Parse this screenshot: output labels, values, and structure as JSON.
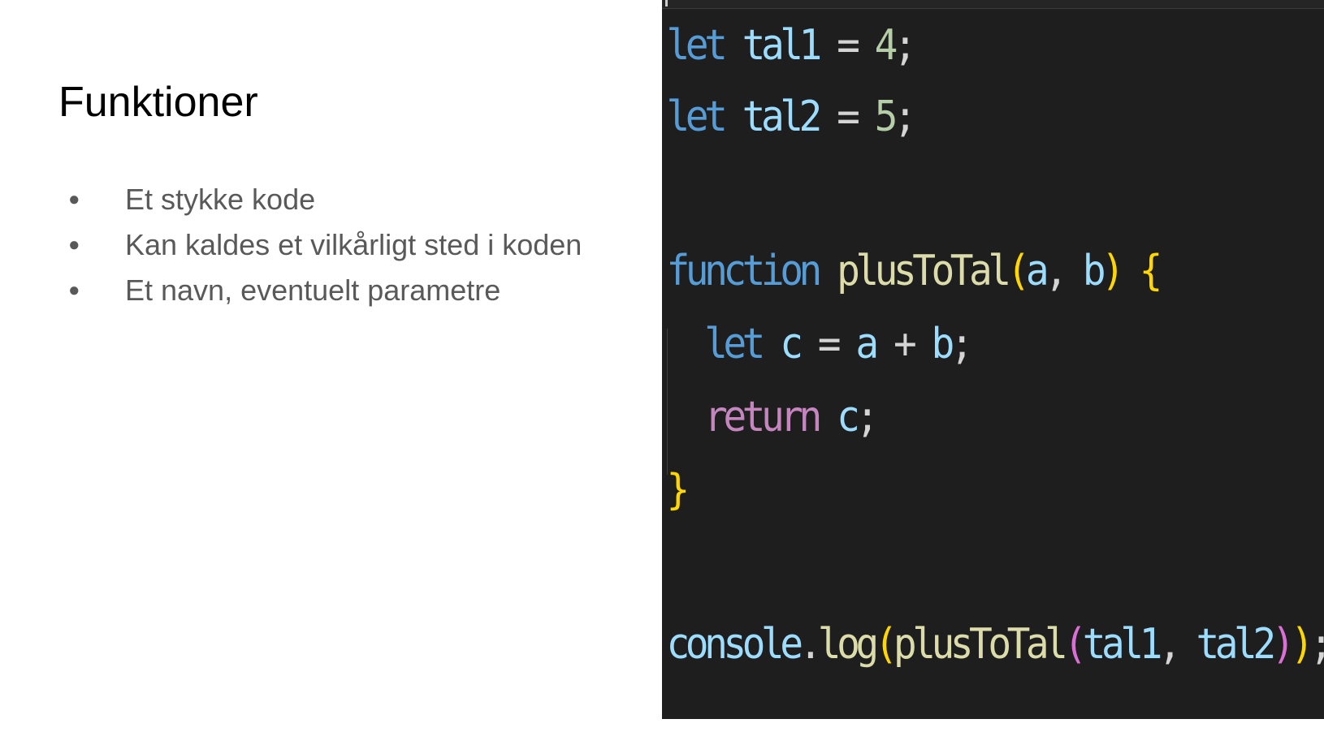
{
  "slide": {
    "title": "Funktioner",
    "bullets": [
      "Et stykke kode",
      "Kan kaldes et vilkårligt sted i koden",
      "Et navn, eventuelt parametre"
    ],
    "bullet_glyph": "●"
  },
  "code": {
    "line1": {
      "kw": "let",
      "name": "tal1",
      "op": "=",
      "value": "4",
      "end": ";"
    },
    "line2": {
      "kw": "let",
      "name": "tal2",
      "op": "=",
      "value": "5",
      "end": ";"
    },
    "line3": {
      "kw": "function",
      "name": "plusToTal",
      "open": "(",
      "p1": "a",
      "comma": ",",
      "p2": "b",
      "close": ")",
      "brace": "{"
    },
    "line4": {
      "kw": "let",
      "name": "c",
      "op": "=",
      "a": "a",
      "plus": "+",
      "b": "b",
      "end": ";"
    },
    "line5": {
      "kw": "return",
      "name": "c",
      "end": ";"
    },
    "line6": {
      "brace": "}"
    },
    "line7": {
      "obj": "console",
      "dot": ".",
      "method": "log",
      "open1": "(",
      "fn": "plusToTal",
      "open2": "(",
      "a1": "tal1",
      "comma": ",",
      "a2": "tal2",
      "close2": ")",
      "close1": ")",
      "end": ";"
    }
  },
  "colors": {
    "keyword": "#569cd6",
    "control": "#c586c0",
    "variable": "#9cdcfe",
    "function": "#dcdcaa",
    "number": "#b5cea8",
    "background": "#1e1e1e"
  }
}
